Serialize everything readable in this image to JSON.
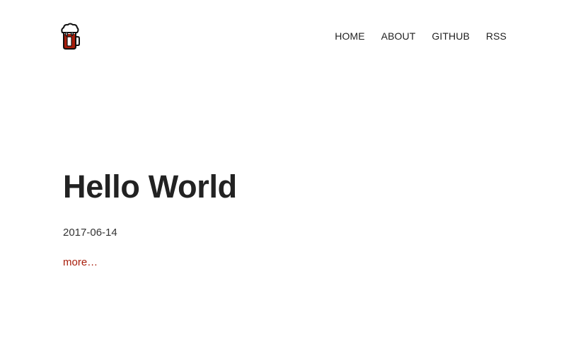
{
  "header": {
    "logo_icon": "beer-mug-icon",
    "nav": [
      {
        "label": "HOME"
      },
      {
        "label": "ABOUT"
      },
      {
        "label": "GITHUB"
      },
      {
        "label": "RSS"
      }
    ]
  },
  "post": {
    "title": "Hello World",
    "date": "2017-06-14",
    "more_label": "more…"
  },
  "colors": {
    "accent": "#a81d0b",
    "text": "#222222",
    "background": "#ffffff"
  }
}
